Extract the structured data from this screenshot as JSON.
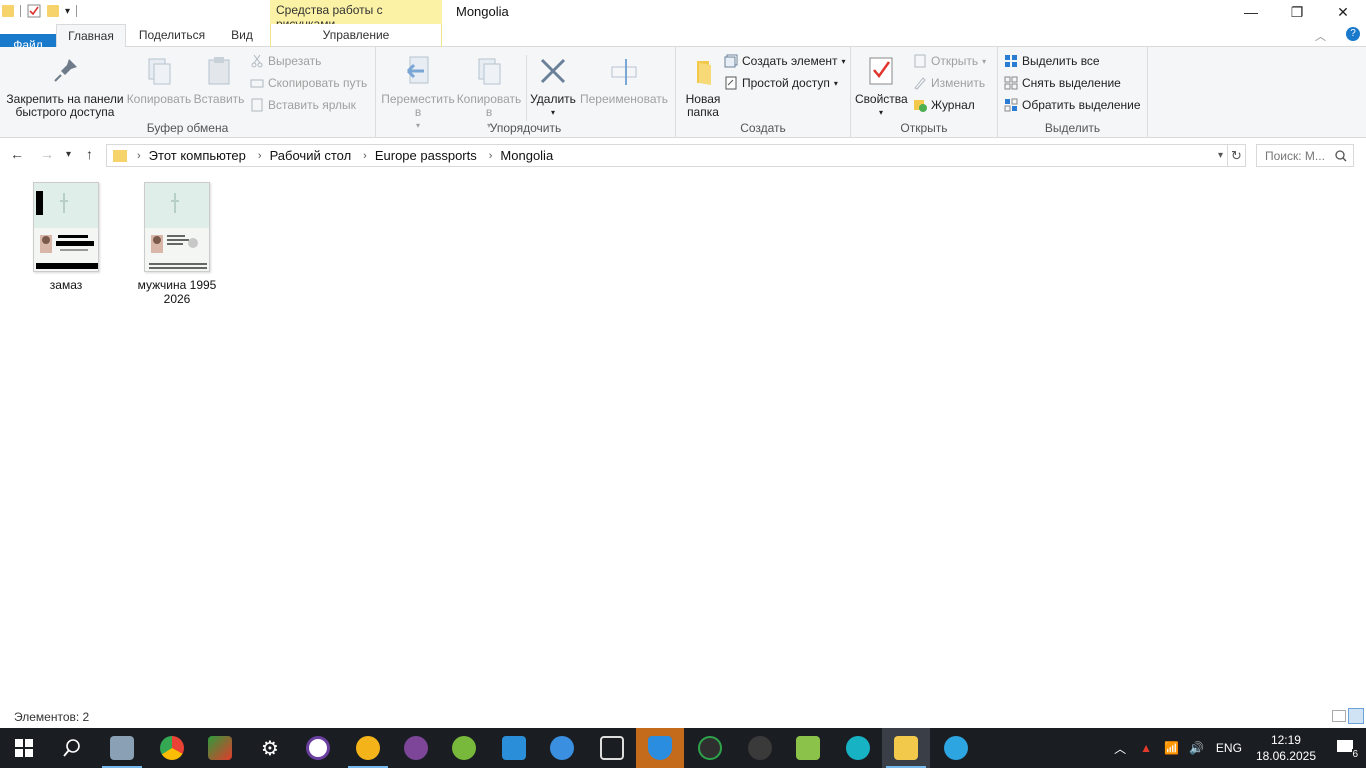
{
  "window": {
    "title": "Mongolia",
    "context_tab_group": "Средства работы с рисунками",
    "minimize": "—",
    "restore": "❐",
    "close": "✕"
  },
  "tabs": {
    "file": "Файл",
    "home": "Главная",
    "share": "Поделиться",
    "view": "Вид",
    "manage": "Управление",
    "help": "?"
  },
  "ribbon": {
    "clipboard": {
      "label": "Буфер обмена",
      "pin": "Закрепить на панели быстрого доступа",
      "copy": "Копировать",
      "paste": "Вставить",
      "cut": "Вырезать",
      "copy_path": "Скопировать путь",
      "paste_shortcut": "Вставить ярлык"
    },
    "organize": {
      "label": "Упорядочить",
      "move_to": "Переместить в",
      "copy_to": "Копировать в",
      "delete": "Удалить",
      "rename": "Переименовать"
    },
    "create": {
      "label": "Создать",
      "new_folder": "Новая папка",
      "new_item": "Создать элемент",
      "easy_access": "Простой доступ"
    },
    "open": {
      "label": "Открыть",
      "properties": "Свойства",
      "open": "Открыть",
      "edit": "Изменить",
      "history": "Журнал"
    },
    "select": {
      "label": "Выделить",
      "select_all": "Выделить все",
      "select_none": "Снять выделение",
      "invert": "Обратить выделение"
    }
  },
  "address": {
    "crumbs": [
      "Этот компьютер",
      "Рабочий стол",
      "Europe passports",
      "Mongolia"
    ],
    "search_placeholder": "Поиск: М..."
  },
  "files": [
    {
      "name": "замаз"
    },
    {
      "name": "мужчина 1995 2026"
    }
  ],
  "status": {
    "items_count": "Элементов: 2"
  },
  "taskbar": {
    "time": "12:19",
    "date": "18.06.2025",
    "lang": "ENG",
    "notifications": "6"
  },
  "colors": {
    "file_tab": "#1979ca",
    "context_tab": "#fbf2a6",
    "taskbar": "#1a1d22"
  }
}
